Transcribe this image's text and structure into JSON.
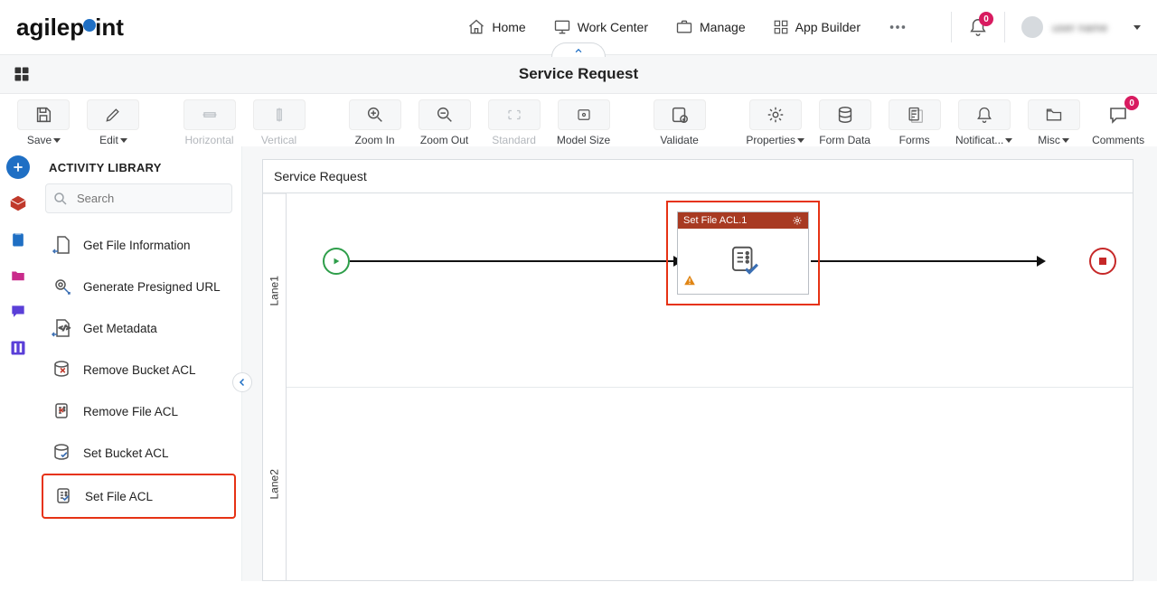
{
  "header": {
    "logo_left": "agilep",
    "logo_right": "int",
    "nav": {
      "home": "Home",
      "work_center": "Work Center",
      "manage": "Manage",
      "app_builder": "App Builder"
    },
    "bell_badge": "0",
    "user_name": "user name"
  },
  "title_bar": {
    "title": "Service Request"
  },
  "toolbar": {
    "save": "Save",
    "edit": "Edit",
    "horizontal": "Horizontal",
    "vertical": "Vertical",
    "zoom_in": "Zoom In",
    "zoom_out": "Zoom Out",
    "standard": "Standard",
    "model_size": "Model Size",
    "validate": "Validate",
    "properties": "Properties",
    "form_data": "Form Data",
    "forms": "Forms",
    "notifications": "Notificat...",
    "misc": "Misc",
    "comments": "Comments",
    "comments_badge": "0"
  },
  "sidebar": {
    "title": "ACTIVITY LIBRARY",
    "search_placeholder": "Search",
    "items": [
      "Get File Information",
      "Generate Presigned URL",
      "Get Metadata",
      "Remove Bucket ACL",
      "Remove File ACL",
      "Set Bucket ACL",
      "Set File ACL"
    ]
  },
  "canvas": {
    "process_name": "Service Request",
    "lane1": "Lane1",
    "lane2": "Lane2",
    "activity_title": "Set File ACL.1"
  }
}
